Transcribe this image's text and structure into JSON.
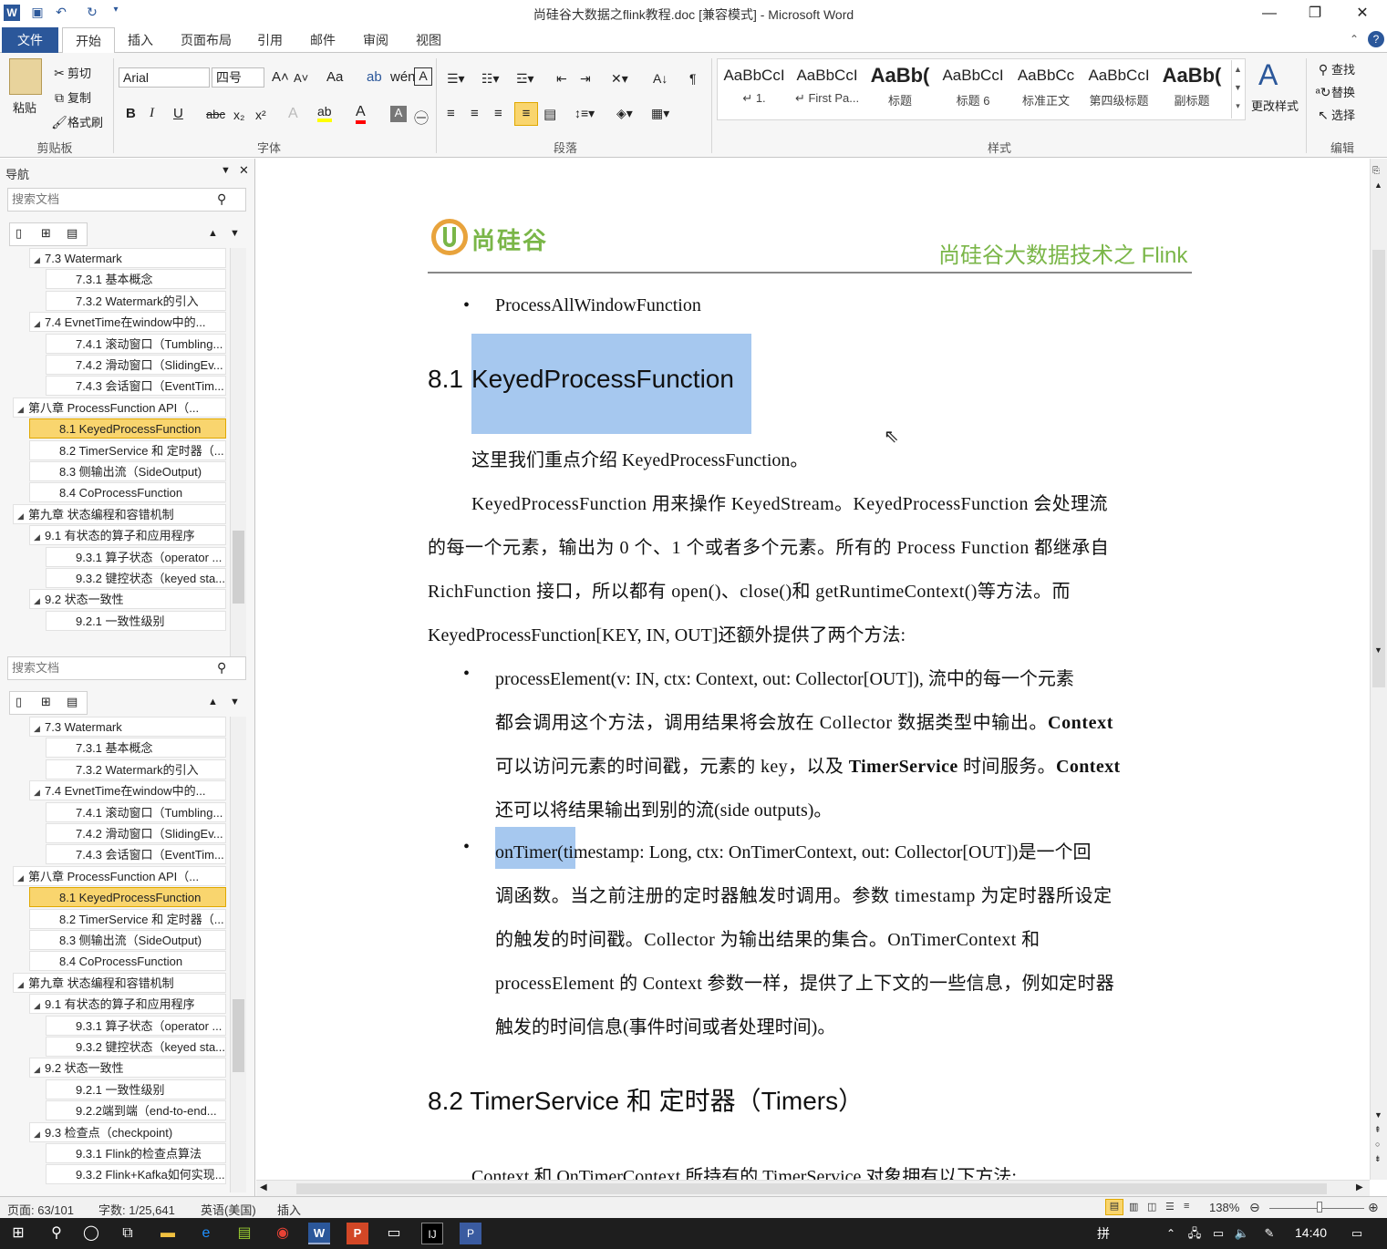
{
  "window": {
    "title": "尚硅谷大数据之flink教程.doc [兼容模式] - Microsoft Word"
  },
  "tabs": [
    "文件",
    "开始",
    "插入",
    "页面布局",
    "引用",
    "邮件",
    "审阅",
    "视图"
  ],
  "ribbon": {
    "clipboard": {
      "paste": "粘贴",
      "cut": "剪切",
      "copy": "复制",
      "format_painter": "格式刷",
      "label": "剪贴板"
    },
    "font": {
      "name": "Arial",
      "size": "四号",
      "label": "字体",
      "grow": "A˄",
      "shrink": "A˅",
      "case": "Aa",
      "bold": "B",
      "italic": "I",
      "underline": "U",
      "strike": "abc",
      "sub": "x₂",
      "sup": "x²"
    },
    "paragraph": {
      "label": "段落"
    },
    "styles": {
      "label": "样式",
      "items": [
        {
          "preview": "AaBbCcI",
          "name": "↵ 1."
        },
        {
          "preview": "AaBbCcI",
          "name": "↵ First Pa..."
        },
        {
          "preview": "AaBb(",
          "name": "标题"
        },
        {
          "preview": "AaBbCcI",
          "name": "标题 6"
        },
        {
          "preview": "AaBbCc",
          "name": "标准正文"
        },
        {
          "preview": "AaBbCcI",
          "name": "第四级标题"
        },
        {
          "preview": "AaBb(",
          "name": "副标题"
        }
      ],
      "change": "更改样式"
    },
    "editing": {
      "find": "查找",
      "replace": "替换",
      "select": "选择",
      "label": "编辑"
    }
  },
  "nav": {
    "title": "导航",
    "search_placeholder": "搜索文档",
    "items_top": [
      {
        "text": "7.3 Watermark",
        "level": 2,
        "tri": "◢",
        "sel": false
      },
      {
        "text": "7.3.1 基本概念",
        "level": 3,
        "tri": "",
        "sel": false
      },
      {
        "text": "7.3.2 Watermark的引入",
        "level": 3,
        "tri": "",
        "sel": false
      },
      {
        "text": "7.4 EvnetTime在window中的...",
        "level": 2,
        "tri": "◢",
        "sel": false
      },
      {
        "text": "7.4.1 滚动窗口（Tumbling...",
        "level": 3,
        "tri": "",
        "sel": false
      },
      {
        "text": "7.4.2 滑动窗口（SlidingEv...",
        "level": 3,
        "tri": "",
        "sel": false
      },
      {
        "text": "7.4.3 会话窗口（EventTim...",
        "level": 3,
        "tri": "",
        "sel": false
      },
      {
        "text": "第八章 ProcessFunction API（...",
        "level": 1,
        "tri": "◢",
        "sel": false
      },
      {
        "text": "8.1 KeyedProcessFunction",
        "level": 2,
        "tri": "",
        "sel": true
      },
      {
        "text": "8.2 TimerService 和 定时器（...",
        "level": 2,
        "tri": "",
        "sel": false
      },
      {
        "text": "8.3 侧输出流（SideOutput)",
        "level": 2,
        "tri": "",
        "sel": false
      },
      {
        "text": "8.4 CoProcessFunction",
        "level": 2,
        "tri": "",
        "sel": false
      },
      {
        "text": "第九章 状态编程和容错机制",
        "level": 1,
        "tri": "◢",
        "sel": false
      },
      {
        "text": "9.1 有状态的算子和应用程序",
        "level": 2,
        "tri": "◢",
        "sel": false
      },
      {
        "text": "9.3.1 算子状态（operator ...",
        "level": 3,
        "tri": "",
        "sel": false
      },
      {
        "text": "9.3.2 键控状态（keyed sta...",
        "level": 3,
        "tri": "",
        "sel": false
      },
      {
        "text": "9.2 状态一致性",
        "level": 2,
        "tri": "◢",
        "sel": false
      },
      {
        "text": "9.2.1 一致性级别",
        "level": 3,
        "tri": "",
        "sel": false
      }
    ],
    "items_bottom": [
      {
        "text": "7.3 Watermark",
        "level": 2,
        "tri": "◢",
        "sel": false
      },
      {
        "text": "7.3.1 基本概念",
        "level": 3,
        "tri": "",
        "sel": false
      },
      {
        "text": "7.3.2 Watermark的引入",
        "level": 3,
        "tri": "",
        "sel": false
      },
      {
        "text": "7.4 EvnetTime在window中的...",
        "level": 2,
        "tri": "◢",
        "sel": false
      },
      {
        "text": "7.4.1 滚动窗口（Tumbling...",
        "level": 3,
        "tri": "",
        "sel": false
      },
      {
        "text": "7.4.2 滑动窗口（SlidingEv...",
        "level": 3,
        "tri": "",
        "sel": false
      },
      {
        "text": "7.4.3 会话窗口（EventTim...",
        "level": 3,
        "tri": "",
        "sel": false
      },
      {
        "text": "第八章 ProcessFunction API（...",
        "level": 1,
        "tri": "◢",
        "sel": false
      },
      {
        "text": "8.1 KeyedProcessFunction",
        "level": 2,
        "tri": "",
        "sel": true
      },
      {
        "text": "8.2 TimerService 和 定时器（...",
        "level": 2,
        "tri": "",
        "sel": false
      },
      {
        "text": "8.3 侧输出流（SideOutput)",
        "level": 2,
        "tri": "",
        "sel": false
      },
      {
        "text": "8.4 CoProcessFunction",
        "level": 2,
        "tri": "",
        "sel": false
      },
      {
        "text": "第九章 状态编程和容错机制",
        "level": 1,
        "tri": "◢",
        "sel": false
      },
      {
        "text": "9.1 有状态的算子和应用程序",
        "level": 2,
        "tri": "◢",
        "sel": false
      },
      {
        "text": "9.3.1 算子状态（operator ...",
        "level": 3,
        "tri": "",
        "sel": false
      },
      {
        "text": "9.3.2 键控状态（keyed sta...",
        "level": 3,
        "tri": "",
        "sel": false
      },
      {
        "text": "9.2 状态一致性",
        "level": 2,
        "tri": "◢",
        "sel": false
      },
      {
        "text": "9.2.1 一致性级别",
        "level": 3,
        "tri": "",
        "sel": false
      },
      {
        "text": "9.2.2端到端（end-to-end...",
        "level": 3,
        "tri": "",
        "sel": false
      },
      {
        "text": "9.3 检查点（checkpoint)",
        "level": 2,
        "tri": "◢",
        "sel": false
      },
      {
        "text": "9.3.1 Flink的检查点算法",
        "level": 3,
        "tri": "",
        "sel": false
      },
      {
        "text": "9.3.2 Flink+Kafka如何实现...",
        "level": 3,
        "tri": "",
        "sel": false
      }
    ]
  },
  "doc": {
    "logo_text": "尚硅谷",
    "header_right": "尚硅谷大数据技术之 Flink",
    "bullet0": "ProcessAllWindowFunction",
    "h81_num": "8.1",
    "h81_title": "KeyedProcessFunction",
    "p1": "这里我们重点介绍 KeyedProcessFunction。",
    "p2": [
      "KeyedProcessFunction 用来操作 KeyedStream。KeyedProcessFunction 会处理流",
      "的每一个元素，输出为 0 个、1 个或者多个元素。所有的 Process Function 都继承自",
      "RichFunction 接口，所以都有 open()、close()和 getRuntimeContext()等方法。而",
      "KeyedProcessFunction[KEY, IN, OUT]还额外提供了两个方法:"
    ],
    "b1": [
      "processElement(v: IN, ctx: Context, out: Collector[OUT]), 流中的每一个元素",
      "都会调用这个方法，调用结果将会放在 Collector 数据类型中输出。",
      "可以访问元素的时间戳，元素的 key，以及 ",
      "时间服务。",
      "还可以将结果输出到别的流(side outputs)。"
    ],
    "b1_bold": [
      "Context",
      "TimerService",
      "Context"
    ],
    "b2_sel": "onTimer(",
    "b2": [
      "timestamp: Long, ctx: OnTimerContext, out: Collector[OUT])是一个回",
      "调函数。当之前注册的定时器触发时调用。参数 timestamp 为定时器所设定",
      "的触发的时间戳。Collector 为输出结果的集合。OnTimerContext 和",
      "processElement 的 Context 参数一样，提供了上下文的一些信息，例如定时器",
      "触发的时间信息(事件时间或者处理时间)。"
    ],
    "h82": "8.2 TimerService 和 定时器（Timers）",
    "p3": "Context 和 OnTimerContext 所持有的 TimerService 对象拥有以下方法:"
  },
  "status": {
    "page": "页面: 63/101",
    "words": "字数: 1/25,641",
    "lang": "英语(美国)",
    "mode": "插入",
    "zoom": "138%"
  },
  "taskbar": {
    "time": "14:40",
    "ime": "拼"
  },
  "colors": {
    "accent": "#2b579a",
    "selection": "#a6c8ef",
    "nav_selected": "#f9d56e",
    "logo_green": "#7ab648"
  }
}
